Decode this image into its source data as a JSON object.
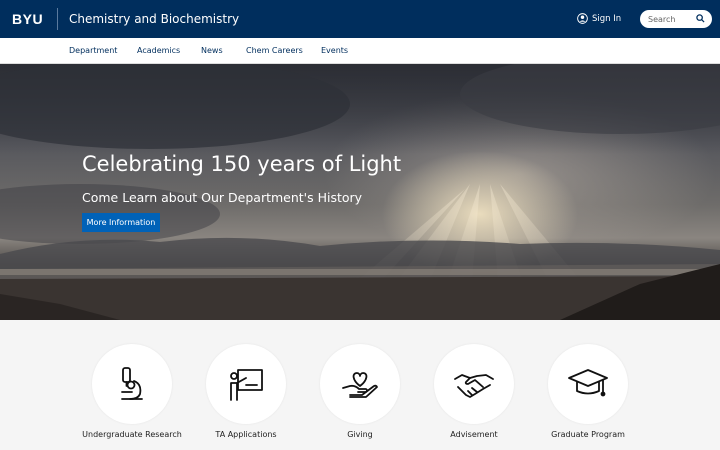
{
  "header": {
    "logo": "BYU",
    "site_title": "Chemistry and Biochemistry",
    "signin_label": "Sign In",
    "search_placeholder": "Search",
    "search_value": "",
    "background": "#002e5d"
  },
  "nav": {
    "items": [
      {
        "label": "Department"
      },
      {
        "label": "Academics"
      },
      {
        "label": "News"
      },
      {
        "label": "Chem Careers"
      },
      {
        "label": "Events"
      }
    ]
  },
  "hero": {
    "title": "Celebrating 150 years of Light",
    "subtitle": "Come Learn about Our Department's History",
    "button_label": "More Information",
    "button_color": "#0062b8"
  },
  "quicklinks": [
    {
      "label": "Undergraduate Research",
      "icon": "microscope-icon"
    },
    {
      "label": "TA Applications",
      "icon": "teacher-board-icon"
    },
    {
      "label": "Giving",
      "icon": "hand-heart-icon"
    },
    {
      "label": "Advisement",
      "icon": "handshake-icon"
    },
    {
      "label": "Graduate Program",
      "icon": "graduation-cap-icon"
    }
  ]
}
